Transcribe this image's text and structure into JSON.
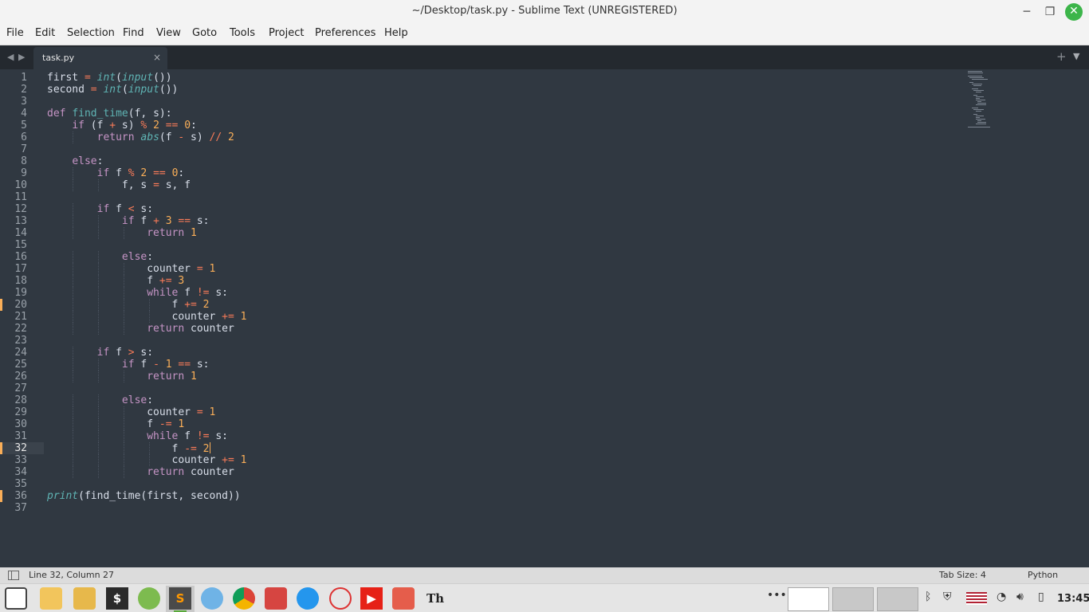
{
  "window": {
    "title": "~/Desktop/task.py - Sublime Text (UNREGISTERED)",
    "minimize_icon": "─",
    "maximize_icon": "❐",
    "close_icon": "✕"
  },
  "menu": [
    "File",
    "Edit",
    "Selection",
    "Find",
    "View",
    "Goto",
    "Tools",
    "Project",
    "Preferences",
    "Help"
  ],
  "tabs": {
    "nav_back": "◀",
    "nav_forward": "▶",
    "active_tab": "task.py",
    "close_glyph": "×",
    "new_tab_glyph": "+",
    "menu_glyph": "▼"
  },
  "editor": {
    "current_line": 32,
    "modified_lines": [
      20,
      32,
      36
    ],
    "line_numbers": [
      "1",
      "2",
      "3",
      "4",
      "5",
      "6",
      "7",
      "8",
      "9",
      "10",
      "11",
      "12",
      "13",
      "14",
      "15",
      "16",
      "17",
      "18",
      "19",
      "20",
      "21",
      "22",
      "23",
      "24",
      "25",
      "26",
      "27",
      "28",
      "29",
      "30",
      "31",
      "32",
      "33",
      "34",
      "35",
      "36",
      "37"
    ],
    "code_lines": [
      "first = int(input())",
      "second = int(input())",
      "",
      "def find_time(f, s):",
      "    if (f + s) % 2 == 0:",
      "        return abs(f - s) // 2",
      "",
      "    else:",
      "        if f % 2 == 0:",
      "            f, s = s, f",
      "",
      "        if f < s:",
      "            if f + 3 == s:",
      "                return 1",
      "",
      "            else:",
      "                counter = 1",
      "                f += 3",
      "                while f != s:",
      "                    f += 2",
      "                    counter += 1",
      "                return counter",
      "",
      "        if f > s:",
      "            if f - 1 == s:",
      "                return 1",
      "",
      "            else:",
      "                counter = 1",
      "                f -= 1",
      "                while f != s:",
      "                    f -= 2",
      "                    counter += 1",
      "                return counter",
      "",
      "print(find_time(first, second))",
      ""
    ]
  },
  "status": {
    "position": "Line 32, Column 27",
    "tab_size": "Tab Size: 4",
    "language": "Python"
  },
  "taskbar": {
    "apps": [
      "mint-menu",
      "files-folder",
      "file-manager",
      "terminal",
      "calculator",
      "sublime-text",
      "browser",
      "chrome",
      "book-reader",
      "docker",
      "target-app",
      "youtube-app",
      "game-app",
      "text-app"
    ],
    "overflow_glyph": "•••",
    "clock": "13:45"
  },
  "colors": {
    "editor_bg": "#303841",
    "keyword": "#c594c5",
    "function": "#5fb4b4",
    "number": "#f9ae58",
    "operator": "#f97b58",
    "text": "#d8dee9"
  }
}
